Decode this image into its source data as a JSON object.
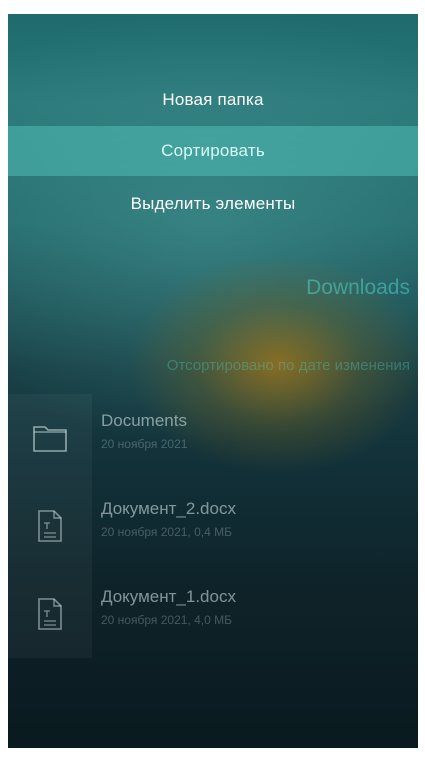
{
  "menu": {
    "items": [
      {
        "label": "Новая папка"
      },
      {
        "label": "Сортировать"
      },
      {
        "label": "Выделить элементы"
      }
    ]
  },
  "header": {
    "title": "Downloads"
  },
  "section": {
    "sort_label": "Отсортировано по дате изменения"
  },
  "files": [
    {
      "name": "Documents",
      "meta": "20 ноября 2021",
      "icon": "folder-icon"
    },
    {
      "name": "Документ_2.docx",
      "meta": "20 ноября 2021, 0,4 МБ",
      "icon": "document-icon"
    },
    {
      "name": "Документ_1.docx",
      "meta": "20 ноября 2021, 4,0 МБ",
      "icon": "document-icon"
    }
  ],
  "colors": {
    "highlight": "#50beb4",
    "accent": "#50d2c8",
    "background_top": "#2a7879",
    "background_bottom": "#0a1a1f"
  }
}
